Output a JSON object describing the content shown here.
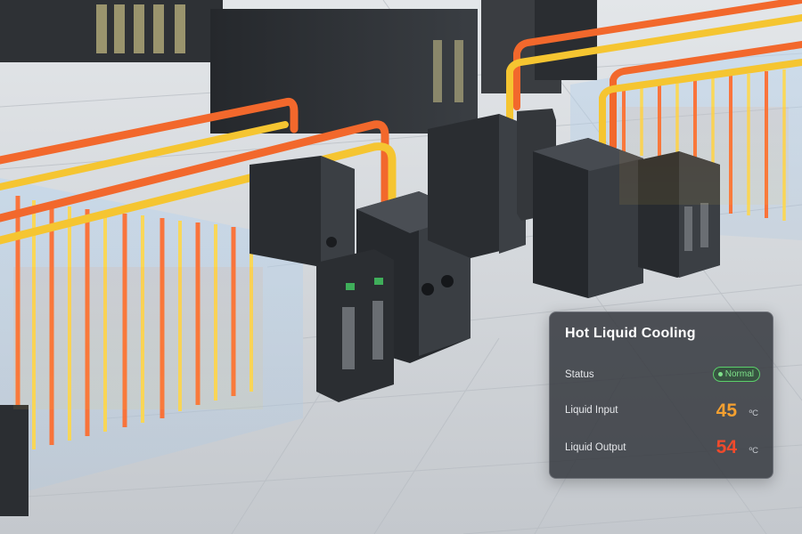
{
  "panel": {
    "title": "Hot Liquid Cooling",
    "status": {
      "label": "Status",
      "value": "Normal",
      "color": "#7fe08a"
    },
    "liquid_input": {
      "label": "Liquid Input",
      "value": "45",
      "unit": "ºC",
      "color": "#f5a030"
    },
    "liquid_output": {
      "label": "Liquid Output",
      "value": "54",
      "unit": "ºC",
      "color": "#f04a2c"
    }
  },
  "colors": {
    "hot_pipe": "#f2682c",
    "warm_pipe": "#f5c531",
    "cabinet": "#2c2f33",
    "floor": "#d4d8dc"
  }
}
